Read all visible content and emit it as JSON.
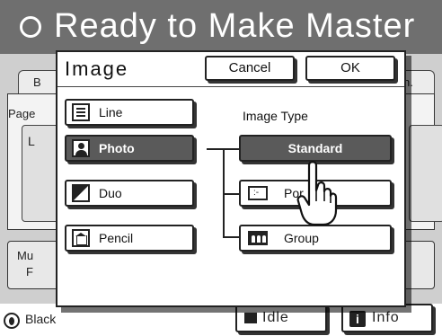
{
  "header": {
    "title": "Ready to Make Master",
    "status_icon": "circle-outline-icon"
  },
  "background": {
    "tab_left_label": "B",
    "tab_right_label": "n.",
    "page_label": "Page",
    "sub_letter": "L",
    "multi_line1": "Mu",
    "multi_line2": "F"
  },
  "dialog": {
    "title": "Image",
    "cancel_label": "Cancel",
    "ok_label": "OK",
    "image_type_label": "Image Type",
    "types": [
      {
        "label": "Line",
        "icon": "line-mode-icon",
        "selected": false
      },
      {
        "label": "Photo",
        "icon": "photo-mode-icon",
        "selected": true
      },
      {
        "label": "Duo",
        "icon": "duo-mode-icon",
        "selected": false
      },
      {
        "label": "Pencil",
        "icon": "pencil-mode-icon",
        "selected": false
      }
    ],
    "sub_types": [
      {
        "label": "Standard",
        "selected": true
      },
      {
        "label": "Por",
        "icon": "portrait-icon",
        "selected": false
      },
      {
        "label": "Group",
        "icon": "group-icon",
        "selected": false
      }
    ]
  },
  "footer": {
    "ink_label": "Black",
    "ink_icon": "ink-drum-icon",
    "idle_label": "Idle",
    "info_label": "Info",
    "info_icon_glyph": "i"
  },
  "colors": {
    "header_bg": "#6f6f6f",
    "selected_bg": "#5a5a5a",
    "panel_bg": "#cfcfcf"
  }
}
